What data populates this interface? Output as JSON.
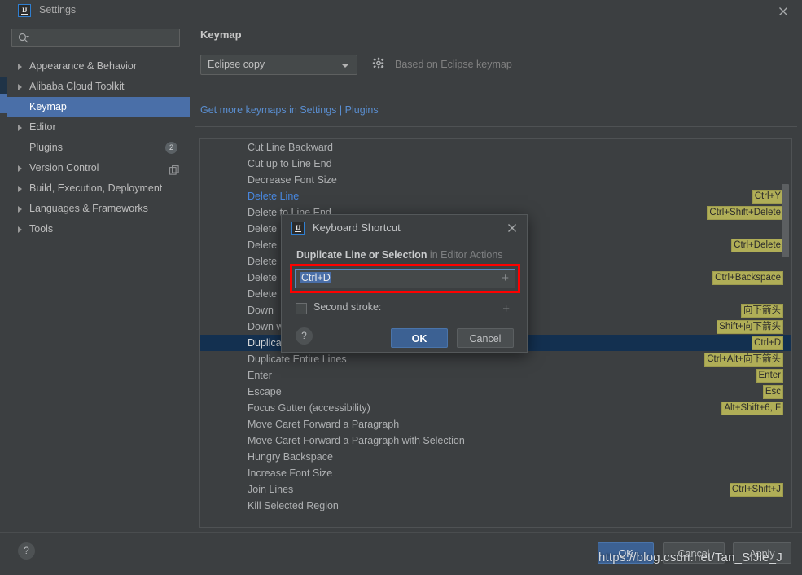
{
  "window": {
    "title": "Settings",
    "logo_text": "IJ",
    "close_icon": "close-icon"
  },
  "sidebar": {
    "search_placeholder": "",
    "search_value": "",
    "items": [
      {
        "label": "Appearance & Behavior",
        "arrow": true,
        "selected": false
      },
      {
        "label": "Alibaba Cloud Toolkit",
        "arrow": true,
        "selected": false
      },
      {
        "label": "Keymap",
        "arrow": false,
        "selected": true
      },
      {
        "label": "Editor",
        "arrow": true,
        "selected": false
      },
      {
        "label": "Plugins",
        "arrow": false,
        "selected": false,
        "badge": "2"
      },
      {
        "label": "Version Control",
        "arrow": true,
        "selected": false,
        "copy_icon": true
      },
      {
        "label": "Build, Execution, Deployment",
        "arrow": true,
        "selected": false
      },
      {
        "label": "Languages & Frameworks",
        "arrow": true,
        "selected": false
      },
      {
        "label": "Tools",
        "arrow": true,
        "selected": false
      }
    ]
  },
  "main": {
    "panel_title": "Keymap",
    "keymap_selected": "Eclipse copy",
    "keymap_options": [
      "Eclipse copy"
    ],
    "gear_icon": "gear-icon",
    "based_on": "Based on Eclipse keymap",
    "get_more_link": "Get more keymaps in Settings | Plugins",
    "toolbar": {
      "expand_all_icon": "expand-all-icon",
      "collapse_all_icon": "collapse-all-icon",
      "edit_icon": "pencil-edit-icon"
    },
    "list_search_value": "",
    "find_icon": "find-by-shortcut-icon"
  },
  "action_list": [
    {
      "name": "Cut Line Backward",
      "shortcut": "",
      "state": "normal"
    },
    {
      "name": "Cut up to Line End",
      "shortcut": "",
      "state": "normal"
    },
    {
      "name": "Decrease Font Size",
      "shortcut": "",
      "state": "normal"
    },
    {
      "name": "Delete Line",
      "shortcut": "Ctrl+Y",
      "state": "modified"
    },
    {
      "name": "Delete to Line End",
      "shortcut": "Ctrl+Shift+Delete",
      "state": "normal"
    },
    {
      "name": "Delete",
      "shortcut": "",
      "state": "normal"
    },
    {
      "name": "Delete",
      "shortcut": "Ctrl+Delete",
      "state": "normal"
    },
    {
      "name": "Delete",
      "shortcut": "",
      "state": "normal"
    },
    {
      "name": "Delete",
      "shortcut": "Ctrl+Backspace",
      "state": "normal"
    },
    {
      "name": "Delete",
      "shortcut": "",
      "state": "normal"
    },
    {
      "name": "Down",
      "shortcut": "向下箭头",
      "state": "normal"
    },
    {
      "name": "Down w",
      "shortcut": "Shift+向下箭头",
      "state": "normal"
    },
    {
      "name": "Duplica",
      "shortcut": "Ctrl+D",
      "state": "selected"
    },
    {
      "name": "Duplicate Entire Lines",
      "shortcut": "Ctrl+Alt+向下箭头",
      "state": "normal"
    },
    {
      "name": "Enter",
      "shortcut": "Enter",
      "state": "normal"
    },
    {
      "name": "Escape",
      "shortcut": "Esc",
      "state": "normal"
    },
    {
      "name": "Focus Gutter (accessibility)",
      "shortcut": "Alt+Shift+6, F",
      "state": "normal"
    },
    {
      "name": "Move Caret Forward a Paragraph",
      "shortcut": "",
      "state": "normal"
    },
    {
      "name": "Move Caret Forward a Paragraph with Selection",
      "shortcut": "",
      "state": "normal"
    },
    {
      "name": "Hungry Backspace",
      "shortcut": "",
      "state": "normal"
    },
    {
      "name": "Increase Font Size",
      "shortcut": "",
      "state": "normal"
    },
    {
      "name": "Join Lines",
      "shortcut": "Ctrl+Shift+J",
      "state": "normal"
    },
    {
      "name": "Kill Selected Region",
      "shortcut": "",
      "state": "normal"
    }
  ],
  "dialog": {
    "logo_text": "IJ",
    "title": "Keyboard Shortcut",
    "close_icon": "close-icon",
    "subject_bold": "Duplicate Line or Selection",
    "subject_context": " in Editor Actions",
    "first_stroke_value": "Ctrl+D",
    "first_stroke_plus": "+",
    "second_stroke_label": "Second stroke:",
    "second_stroke_value": "",
    "second_stroke_plus": "+",
    "second_stroke_checked": false,
    "help_label": "?",
    "ok_label": "OK",
    "cancel_label": "Cancel"
  },
  "bottom": {
    "help_label": "?",
    "ok_label": "OK",
    "cancel_label": "Cancel",
    "apply_label": "Apply"
  },
  "watermark": "https://blog.csdn.net/Tan_SiJie_J",
  "colors": {
    "window_bg": "#3c3f41",
    "selection_blue": "#4a6fa8",
    "row_selected": "#133050",
    "link_blue": "#5a8ed0",
    "modified_blue": "#4887df",
    "shortcut_badge": "#b0ae57",
    "highlight_red": "#fd0100",
    "primary_button": "#3c6193"
  }
}
